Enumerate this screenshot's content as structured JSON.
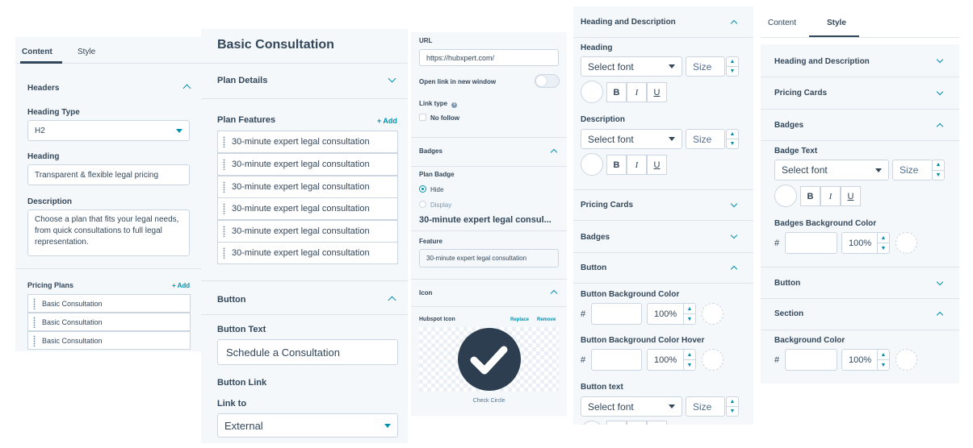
{
  "p1": {
    "tabs": [
      "Content",
      "Style"
    ],
    "headers_title": "Headers",
    "heading_type_label": "Heading Type",
    "heading_type_value": "H2",
    "heading_label": "Heading",
    "heading_value": "Transparent & flexible legal pricing",
    "description_label": "Description",
    "description_value": "Choose a plan that fits your legal needs, from quick consultations to full legal representation.",
    "pricing_plans_label": "Pricing Plans",
    "add_label": "+ Add",
    "plans": [
      "Basic Consultation",
      "Basic Consultation",
      "Basic Consultation"
    ]
  },
  "p2": {
    "title": "Basic Consultation",
    "plan_details": "Plan Details",
    "plan_features": "Plan Features",
    "add_label": "+ Add",
    "features": [
      "30-minute expert legal consultation",
      "30-minute expert legal consultation",
      "30-minute expert legal consultation",
      "30-minute expert legal consultation",
      "30-minute expert legal consultation",
      "30-minute expert legal consultation"
    ],
    "button_title": "Button",
    "button_text_label": "Button Text",
    "button_text_value": "Schedule a Consultation",
    "button_link_label": "Button Link",
    "link_to_label": "Link to",
    "link_to_value": "External"
  },
  "p3": {
    "url_label": "URL",
    "url_value": "https://hubxpert.com/",
    "open_new_window": "Open link in new window",
    "link_type_label": "Link type",
    "no_follow": "No follow",
    "badges_title": "Badges",
    "plan_badge_label": "Plan Badge",
    "radio_hide": "Hide",
    "radio_display": "Display",
    "feature_title": "30-minute expert legal consul...",
    "feature_label": "Feature",
    "feature_value": "30-minute expert legal consultation",
    "icon_title": "Icon",
    "hubspot_icon_label": "Hubspot Icon",
    "replace": "Replace",
    "remove": "Remove",
    "icon_caption": "Check Circle"
  },
  "p4": {
    "hd_title": "Heading and Description",
    "heading_label": "Heading",
    "select_font": "Select font",
    "size": "Size",
    "description_label": "Description",
    "pricing_cards": "Pricing Cards",
    "badges": "Badges",
    "button": "Button",
    "btn_bg_label": "Button Background Color",
    "btn_bg_hover_label": "Button Background Color Hover",
    "btn_text_label": "Button text",
    "hash": "#",
    "percent": "100%",
    "fmt": [
      "B",
      "I",
      "U"
    ]
  },
  "p5": {
    "tabs": [
      "Content",
      "Style"
    ],
    "hd": "Heading and Description",
    "pricing_cards": "Pricing Cards",
    "badges": "Badges",
    "badge_text_label": "Badge Text",
    "select_font": "Select font",
    "size": "Size",
    "badges_bg_label": "Badges Background Color",
    "hash": "#",
    "percent": "100%",
    "button": "Button",
    "section": "Section",
    "bg_color_label": "Background Color",
    "fmt": [
      "B",
      "I",
      "U"
    ]
  }
}
